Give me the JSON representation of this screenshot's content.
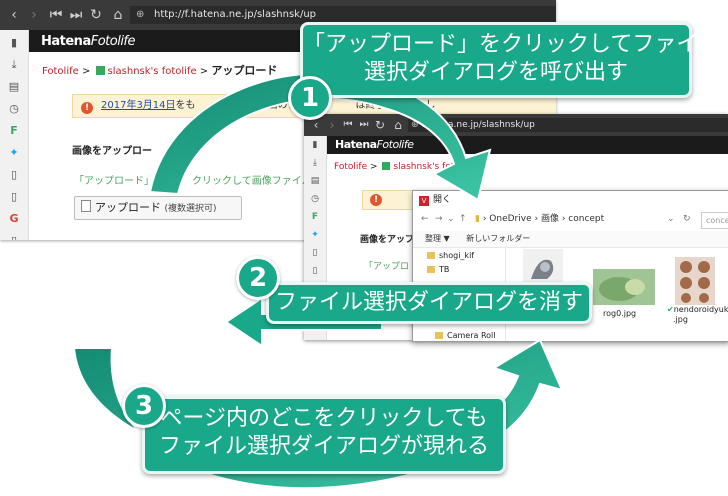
{
  "browser1": {
    "url": "http://f.hatena.ne.jp/slashnsk/up",
    "logo": {
      "bold": "Hatena",
      "rest": "Fotolife"
    },
    "breadcrumb": {
      "root": "Fotolife",
      "sep1": " > ",
      "user": "slashnsk's fotolife",
      "sep2": " > ",
      "current": "アップロード"
    },
    "notice": {
      "date_link": "2017年3月14日",
      "text": "をも",
      "tail": "画のアップロ",
      "tail2": "は終了いたしまし"
    },
    "section_title": "画像をアップロー",
    "description": {
      "start": "「アップロード」ボ",
      "end": "クリックして画像ファイル"
    },
    "upload_button": {
      "label": "アップロード",
      "sub": "(複数選択可)"
    }
  },
  "browser2": {
    "url": "hatena.ne.jp/slashnsk/up",
    "logo": {
      "bold": "Hatena",
      "rest": "Fotolife"
    },
    "breadcrumb": {
      "root": "Fotolife",
      "sep1": " > ",
      "user": "slashnsk's fotolif"
    },
    "section_title": "画像をアップ",
    "description_start": "「アップロ"
  },
  "dialog": {
    "title": "開く",
    "path": [
      "OneDrive",
      "画像",
      "concept"
    ],
    "search_placeholder": "conce",
    "commands": {
      "organize": "整理 ▼",
      "new_folder": "新しいフォルダー"
    },
    "tree": [
      "shogi_kif",
      "TB",
      "Camera Roll"
    ],
    "files": [
      {
        "name": "rog0.jpg"
      },
      {
        "name": "nendoroidyukari",
        "ext": ".jpg"
      }
    ]
  },
  "callouts": {
    "step1": {
      "number": "1",
      "line1": "「アップロード」をクリックしてファイル",
      "line2": "選択ダイアログを呼び出す"
    },
    "step2": {
      "number": "2",
      "line1": "ファイル選択ダイアログを消す"
    },
    "step3": {
      "number": "3",
      "line1": "ページ内のどこをクリックしても",
      "line2": "ファイル選択ダイアログが現れる"
    }
  },
  "colors": {
    "accent": "#1aa88b",
    "arrow_dark": "#128a72",
    "arrow_light": "#3dc7a6"
  }
}
